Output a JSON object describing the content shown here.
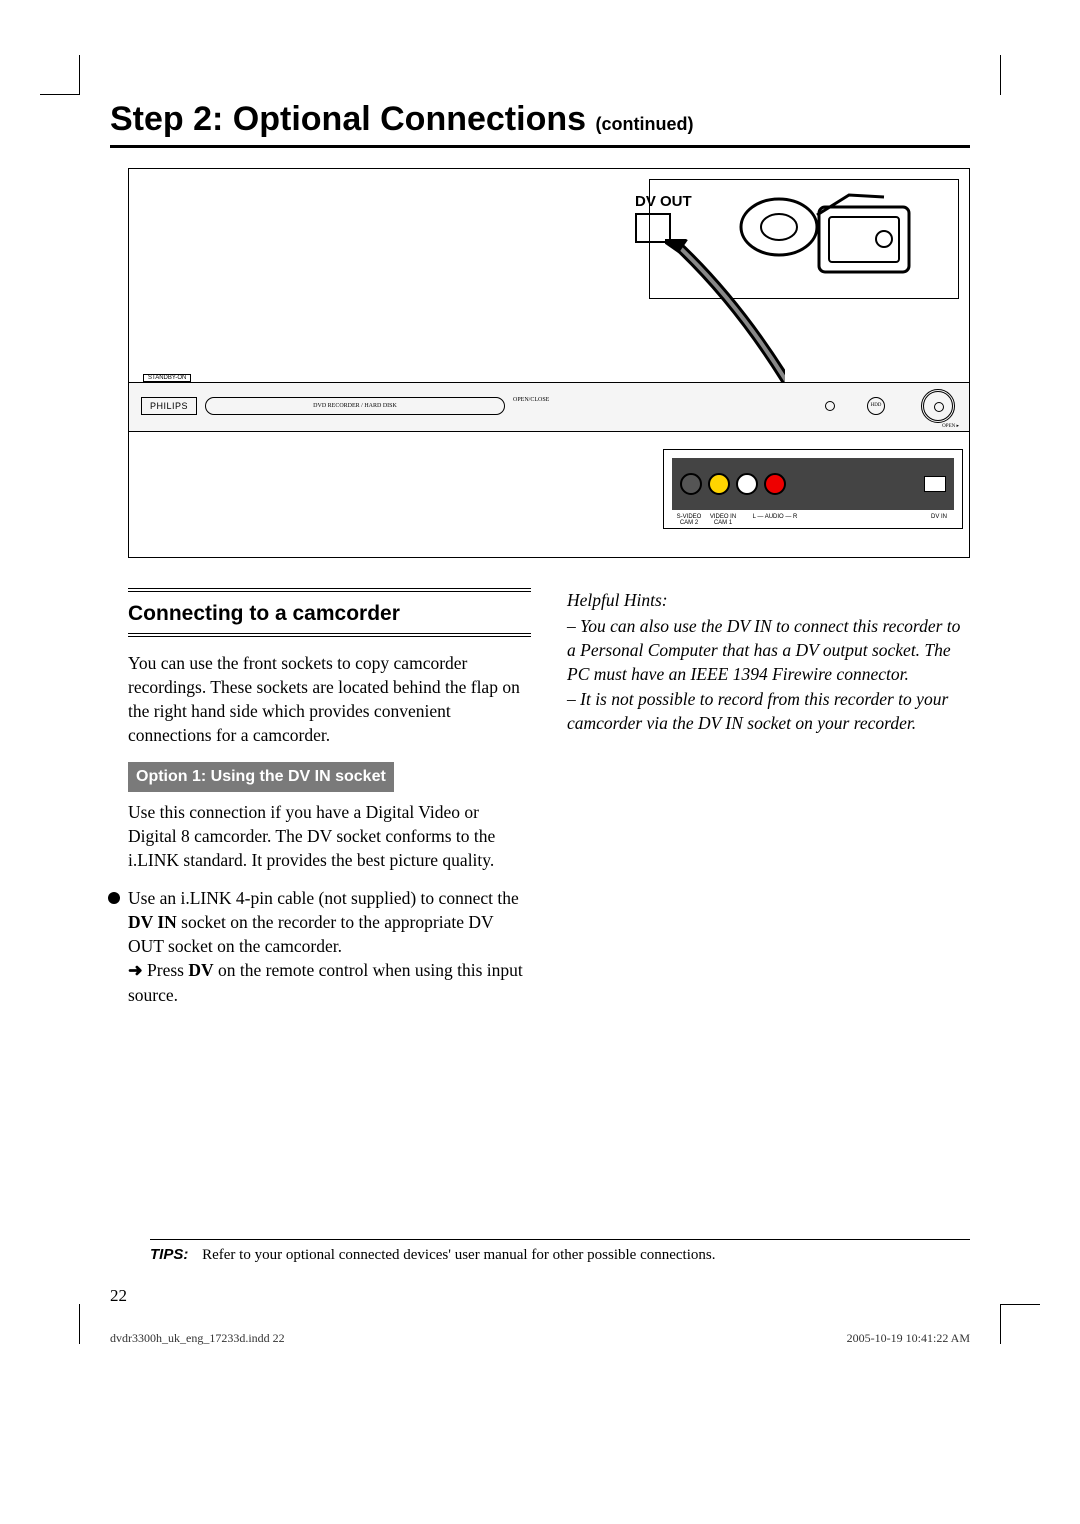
{
  "heading": {
    "main": "Step 2: Optional Connections ",
    "cont": "(continued)"
  },
  "figure": {
    "dv_out": "DV OUT",
    "standby": "STANDBY-ON",
    "brand": "PHILIPS",
    "tray": "DVD RECORDER / HARD DISK",
    "open_close": "OPEN/CLOSE",
    "hdd": "HDD",
    "open": "OPEN ▸",
    "panel_labels": {
      "svideo": "S-VIDEO",
      "cam2": "CAM 2",
      "videoin": "VIDEO IN",
      "cam1": "CAM 1",
      "audio": "L — AUDIO — R",
      "dvin": "DV IN"
    }
  },
  "left": {
    "section_title": "Connecting to a camcorder",
    "p1": "You can use the front sockets to copy camcorder recordings. These sockets are located behind the flap on the right hand side which provides convenient connections for a camcorder.",
    "option1_label": "Option 1: Using the DV IN socket",
    "p2": "Use this connection if you have a Digital Video or Digital 8 camcorder. The DV socket conforms to the i.LINK standard. It provides the best picture quality.",
    "bullet_a": "Use an i.LINK 4-pin cable (not supplied) to connect the ",
    "bullet_a_bold": "DV IN",
    "bullet_a2": " socket on the recorder to the appropriate DV OUT socket on the camcorder.",
    "arrow": "➜",
    "sub_a": " Press ",
    "sub_bold": "DV",
    "sub_b": " on the remote control when using this input source."
  },
  "right": {
    "hints_title": "Helpful Hints:",
    "h1": "– You can also use the DV IN to connect this recorder to a Personal Computer that has a DV output socket. The PC must have an IEEE 1394 Firewire connector.",
    "h2": "– It is not possible to record from this recorder to your camcorder via the DV IN socket on your recorder."
  },
  "tips": {
    "label": "TIPS:",
    "text": "Refer to your optional connected devices' user manual for other possible connections."
  },
  "page_number": "22",
  "footer": {
    "file": "dvdr3300h_uk_eng_17233d.indd   22",
    "timestamp": "2005-10-19   10:41:22 AM"
  }
}
